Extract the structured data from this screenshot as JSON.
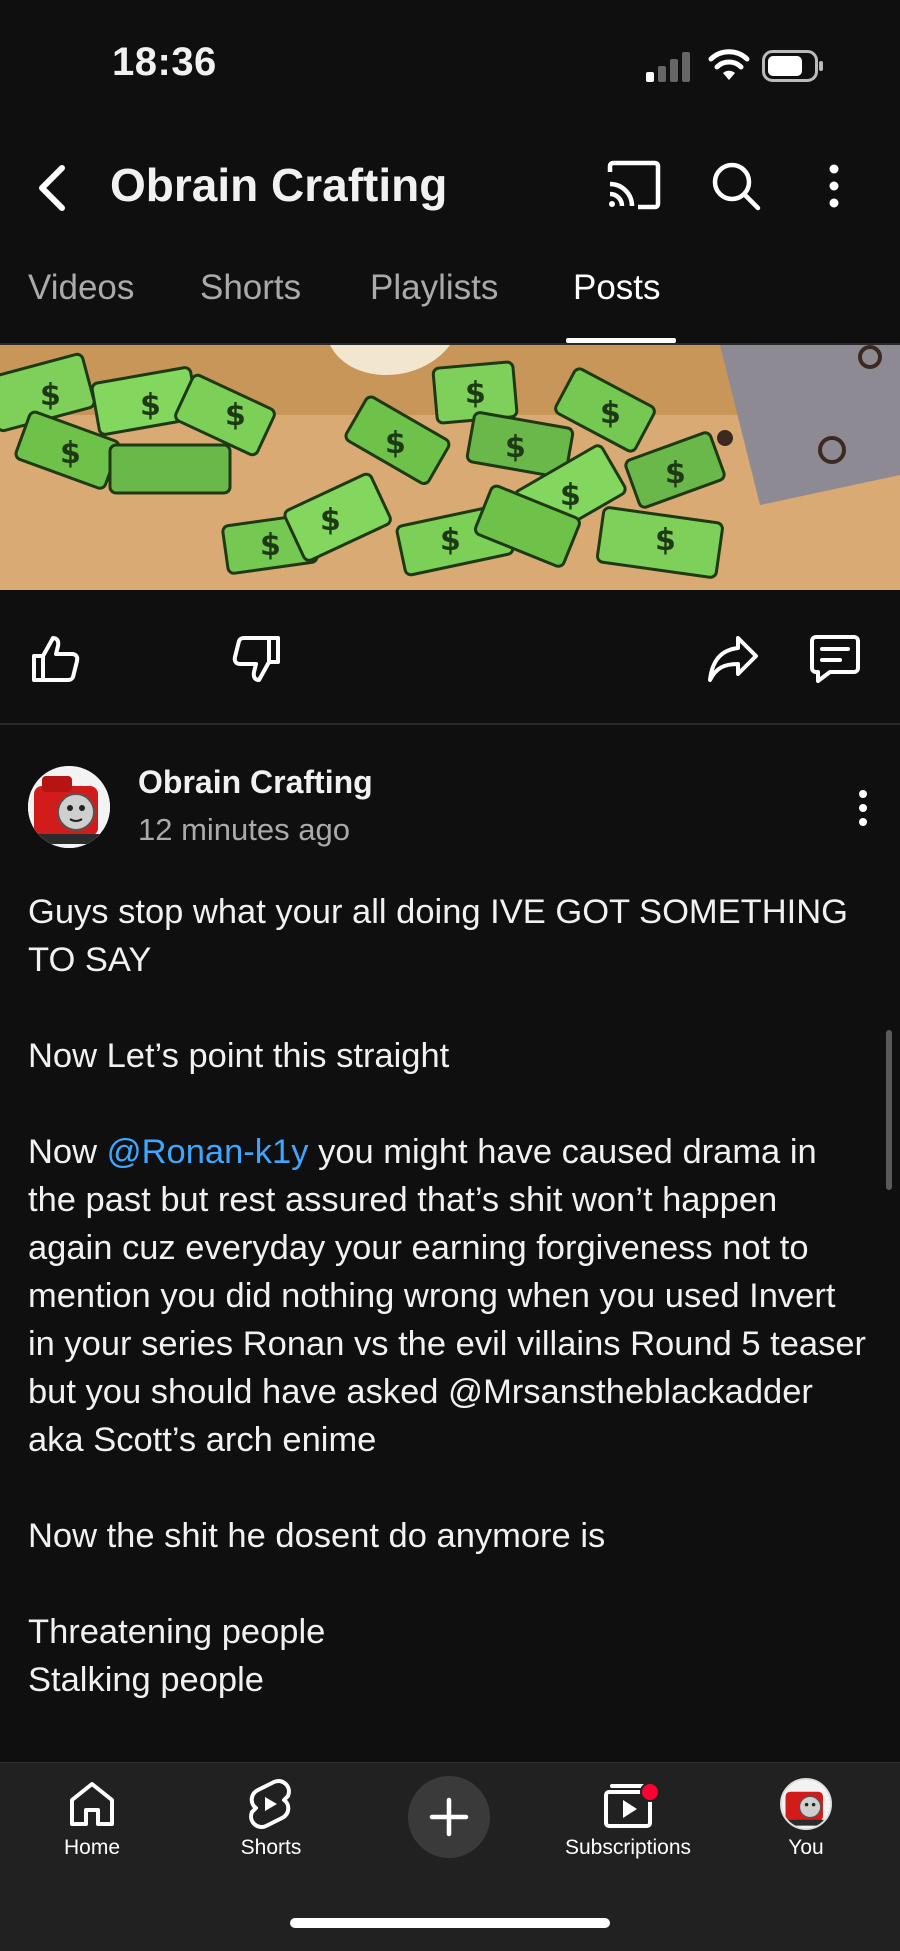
{
  "status_bar": {
    "time": "18:36"
  },
  "header": {
    "channel_name": "Obrain Crafting"
  },
  "tabs": [
    {
      "label": "Videos",
      "active": false
    },
    {
      "label": "Shorts",
      "active": false
    },
    {
      "label": "Playlists",
      "active": false
    },
    {
      "label": "Posts",
      "active": true
    }
  ],
  "post": {
    "author": "Obrain Crafting",
    "time_ago": "12 minutes ago",
    "body": {
      "p1": "Guys stop what your all doing IVE GOT SOMETHING TO SAY",
      "p2": "Now Let’s point this straight",
      "p3_pre": "Now ",
      "p3_mention": "@Ronan-k1y",
      "p3_post": " you might have caused drama in the past but rest assured that’s shit won’t happen again cuz everyday your earning forgiveness not to mention you did nothing wrong when you used Invert in your series Ronan vs the evil villains Round 5 teaser but you should have asked @Mrsanstheblackadder aka Scott’s arch enime",
      "p4": "Now the shit he dosent do anymore is",
      "list1": "Threatening people",
      "list2": "Stalking people"
    }
  },
  "bottom_nav": {
    "home": "Home",
    "shorts": "Shorts",
    "subscriptions": "Subscriptions",
    "you": "You"
  },
  "colors": {
    "mention": "#3ea6ff",
    "notification_dot": "#ff0033",
    "background": "#0f0f0f"
  }
}
